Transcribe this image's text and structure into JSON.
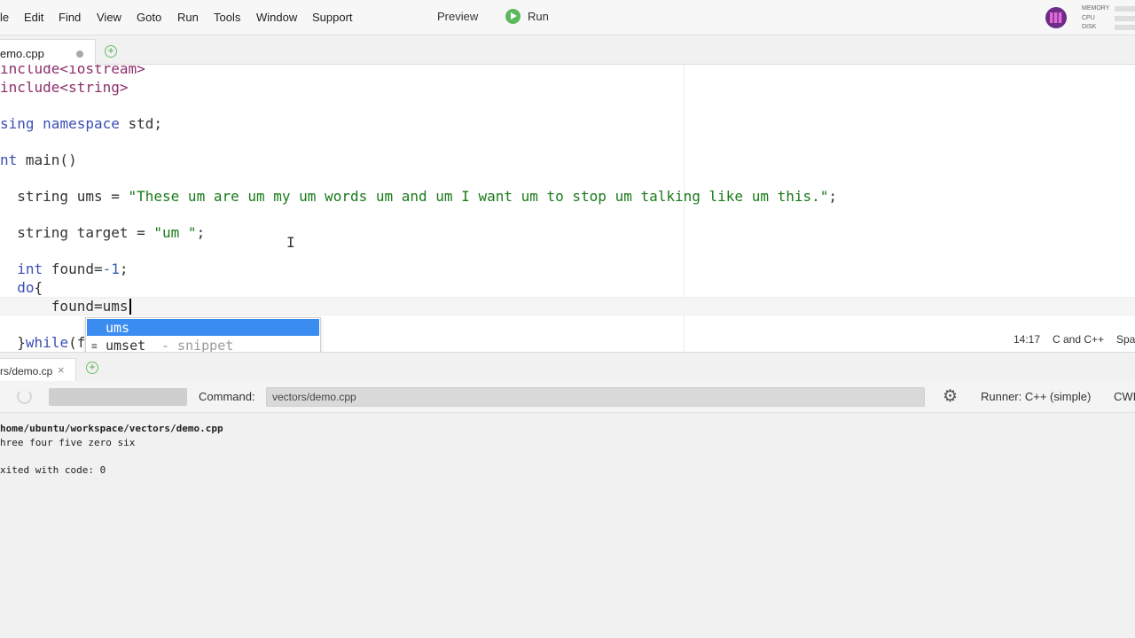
{
  "menu": [
    "le",
    "Edit",
    "Find",
    "View",
    "Goto",
    "Run",
    "Tools",
    "Window",
    "Support"
  ],
  "toolbar": {
    "preview": "Preview",
    "run": "Run"
  },
  "monitor": [
    "MEMORY",
    "CPU",
    "DISK"
  ],
  "editor_tab": {
    "label": "emo.cpp"
  },
  "code": [
    [
      [
        "op",
        "include<iostream>"
      ]
    ],
    [
      [
        "op",
        "include<string>"
      ]
    ],
    [
      [
        "kw",
        "sing"
      ],
      [
        "t",
        " "
      ],
      [
        "kw",
        "namespace"
      ],
      [
        "t",
        " std;"
      ]
    ],
    [
      [
        "kw",
        "nt"
      ],
      [
        "t",
        " main()"
      ]
    ],
    [
      [
        "t",
        "  string ums = "
      ],
      [
        "str",
        "\"These um are um my um words um and um I want um to stop um talking like um this.\""
      ],
      [
        "t",
        ";"
      ]
    ],
    [
      [
        "t",
        "  string target = "
      ],
      [
        "str",
        "\"um \""
      ],
      [
        "t",
        ";"
      ]
    ],
    [
      [
        "t",
        "  "
      ],
      [
        "kw",
        "int"
      ],
      [
        "t",
        " found="
      ],
      [
        "num",
        "-1"
      ],
      [
        "t",
        ";"
      ]
    ],
    [
      [
        "t",
        "  "
      ],
      [
        "kw",
        "do"
      ],
      [
        "t",
        "{"
      ]
    ],
    [
      [
        "t",
        "      found=ums"
      ]
    ],
    [
      [
        "t",
        "  }"
      ],
      [
        "kw",
        "while"
      ],
      [
        "t",
        "(f"
      ]
    ]
  ],
  "autocomplete": {
    "items": [
      {
        "label": "ums",
        "meta": ""
      },
      {
        "icon": "≡",
        "label": "umset",
        "meta": "- snippet"
      }
    ]
  },
  "editor_status": {
    "position": "14:17",
    "language": "C and C++",
    "spaces": "Spa"
  },
  "console_tab": {
    "label": "rs/demo.cp"
  },
  "runner": {
    "command_label": "Command:",
    "command_value": "vectors/demo.cpp",
    "runner": "Runner: C++ (simple)",
    "cwd": "CWI"
  },
  "console_output": [
    "home/ubuntu/workspace/vectors/demo.cpp",
    "hree four five zero six",
    "",
    "xited with code: 0"
  ]
}
